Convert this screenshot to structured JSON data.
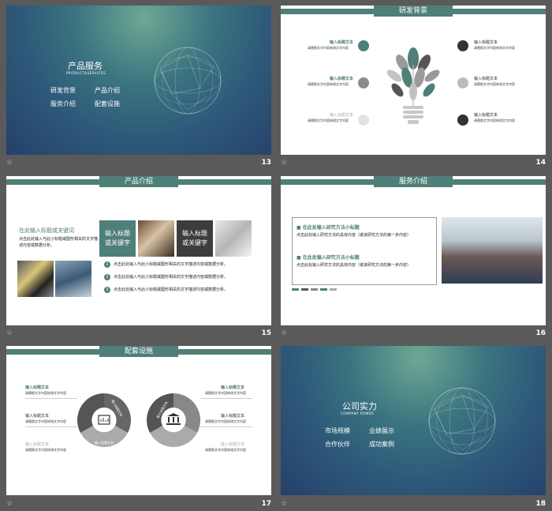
{
  "slides": [
    {
      "num": "13",
      "title": "产品服务",
      "subtitle": "PRODUCT&SERVICES",
      "menu": [
        "研发背景",
        "产品介绍",
        "服务介绍",
        "配套设施"
      ]
    },
    {
      "num": "14",
      "header": "研发背景",
      "items": [
        {
          "title": "输入标题文本",
          "desc": "请替换文字内容修改文字内容"
        },
        {
          "title": "输入标题文本",
          "desc": "请替换文字内容修改文字内容"
        },
        {
          "title": "输入标题文本",
          "desc": "请替换文字内容修改文字内容"
        },
        {
          "title": "输入标题文本",
          "desc": "请替换文字内容修改文字内容"
        },
        {
          "title": "输入标题文本",
          "desc": "请替换文字内容修改文字内容"
        },
        {
          "title": "输入标题文本",
          "desc": "请替换文字内容修改文字内容"
        }
      ]
    },
    {
      "num": "15",
      "header": "产品介绍",
      "heading": "在此输入标题或关键词",
      "para": "点击此处输入与此小标题或图形相关的文字描述内容或数据分析。",
      "tile1": "输入标题\n或关键字",
      "tile2": "输入标题\n或关键字",
      "points": [
        {
          "n": "1",
          "text": "点击此处输入与此小标题或图形相关的文字描述内容或数据分析。"
        },
        {
          "n": "2",
          "text": "点击此处输入与此小标题或图形相关的文字描述内容或数据分析。"
        },
        {
          "n": "3",
          "text": "点击此处输入与此小标题或图形相关的文字描述内容或数据分析。"
        }
      ]
    },
    {
      "num": "16",
      "header": "服务介绍",
      "blocks": [
        {
          "title": "在此处输入研究方法小标题",
          "text": "点击此处输入研究方法的具体内容（或该研究方法的第一步内容）"
        },
        {
          "title": "在此处输入研究方法小标题",
          "text": "点击此处输入研究方法的具体内容（或该研究方法的第一步内容）"
        }
      ]
    },
    {
      "num": "17",
      "header": "配套设施",
      "left_items": [
        {
          "title": "输入标题文本",
          "desc": "请替换文字内容修改文字内容"
        },
        {
          "title": "输入标题文本",
          "desc": "请替换文字内容修改文字内容"
        },
        {
          "title": "输入标题文本",
          "desc": "请替换文字内容修改文字内容"
        }
      ],
      "right_items": [
        {
          "title": "输入标题文本",
          "desc": "请替换文字内容修改文字内容"
        },
        {
          "title": "输入标题文本",
          "desc": "请替换文字内容修改文字内容"
        },
        {
          "title": "输入标题文本",
          "desc": "请替换文字内容修改文字内容"
        }
      ],
      "ring_labels": [
        "输入标题文本",
        "输入标题文本",
        "输入标题文本"
      ]
    },
    {
      "num": "18",
      "title": "公司实力",
      "subtitle": "COMPANY  POWER",
      "menu": [
        "市场规模",
        "业绩展示",
        "合作伙伴",
        "成功案例"
      ]
    }
  ],
  "colors": {
    "accent": "#4f7f79",
    "dark_bg": "#2e5a7a",
    "page_bg": "#5a5a5a"
  },
  "icons": {
    "footer": "star-outline-icon"
  }
}
